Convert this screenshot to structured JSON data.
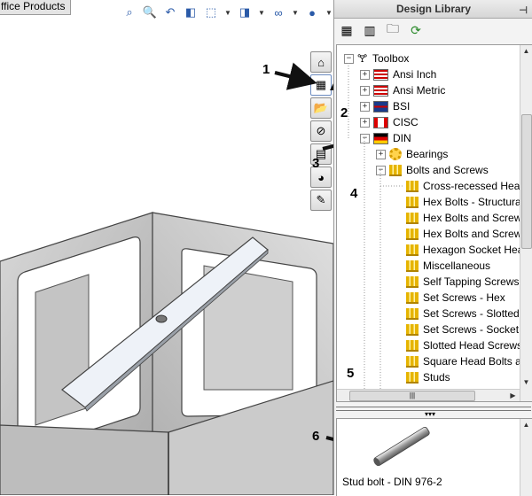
{
  "document_tab": {
    "label": "ffice Products"
  },
  "view_toolbar": {
    "icons": [
      "zoom-to-fit-icon",
      "zoom-area-icon",
      "previous-view-icon",
      "section-view-icon",
      "view-orientation-icon",
      "display-style-icon",
      "hide-show-icon",
      "appearance-icon",
      "scene-icon"
    ]
  },
  "taskpane_tabs": [
    "home-icon",
    "design-library-icon",
    "file-explorer-icon",
    "search-icon",
    "view-palette-icon",
    "appearances-icon",
    "custom-properties-icon"
  ],
  "callouts": [
    "1",
    "2",
    "3",
    "4",
    "5",
    "6"
  ],
  "panel": {
    "title": "Design Library",
    "toolbar_icons": [
      "add-to-library-icon",
      "add-file-location-icon",
      "create-folder-icon",
      "refresh-icon"
    ],
    "tree": [
      {
        "label": "Toolbox",
        "level": 0,
        "expander": "−",
        "icon": "toolbox-icon"
      },
      {
        "label": "Ansi Inch",
        "level": 1,
        "expander": "+",
        "icon": "flag-us-icon"
      },
      {
        "label": "Ansi Metric",
        "level": 1,
        "expander": "+",
        "icon": "flag-us-icon"
      },
      {
        "label": "BSI",
        "level": 1,
        "expander": "+",
        "icon": "flag-uk-icon"
      },
      {
        "label": "CISC",
        "level": 1,
        "expander": "+",
        "icon": "flag-canada-icon"
      },
      {
        "label": "DIN",
        "level": 1,
        "expander": "−",
        "icon": "flag-germany-icon"
      },
      {
        "label": "Bearings",
        "level": 2,
        "expander": "+",
        "icon": "bearing-icon"
      },
      {
        "label": "Bolts and Screws",
        "level": 2,
        "expander": "−",
        "icon": "bolt-folder-icon"
      },
      {
        "label": "Cross-recessed Head",
        "level": 3,
        "icon": "bolt-folder-icon"
      },
      {
        "label": "Hex Bolts - Structural",
        "level": 3,
        "icon": "bolt-folder-icon"
      },
      {
        "label": "Hex Bolts and Screws",
        "level": 3,
        "icon": "bolt-folder-icon"
      },
      {
        "label": "Hex Bolts and Screws",
        "level": 3,
        "icon": "bolt-folder-icon"
      },
      {
        "label": "Hexagon Socket Head",
        "level": 3,
        "icon": "bolt-folder-icon"
      },
      {
        "label": "Miscellaneous",
        "level": 3,
        "icon": "bolt-folder-icon"
      },
      {
        "label": "Self Tapping Screws",
        "level": 3,
        "icon": "bolt-folder-icon"
      },
      {
        "label": "Set Screws - Hex",
        "level": 3,
        "icon": "bolt-folder-icon"
      },
      {
        "label": "Set Screws - Slotted",
        "level": 3,
        "icon": "bolt-folder-icon"
      },
      {
        "label": "Set Screws - Socket",
        "level": 3,
        "icon": "bolt-folder-icon"
      },
      {
        "label": "Slotted Head Screws",
        "level": 3,
        "icon": "bolt-folder-icon"
      },
      {
        "label": "Square Head Bolts a",
        "level": 3,
        "icon": "bolt-folder-icon"
      },
      {
        "label": "Studs",
        "level": 3,
        "icon": "bolt-folder-icon"
      }
    ],
    "preview": {
      "caption": "Stud bolt - DIN 976-2"
    }
  },
  "colors": {
    "panel_bg": "#f3f3f3",
    "tree_bg": "#ffffff",
    "cad_face": "#c8c8c8",
    "cad_edge": "#4a4a4a",
    "strap": "#e8edf5"
  }
}
